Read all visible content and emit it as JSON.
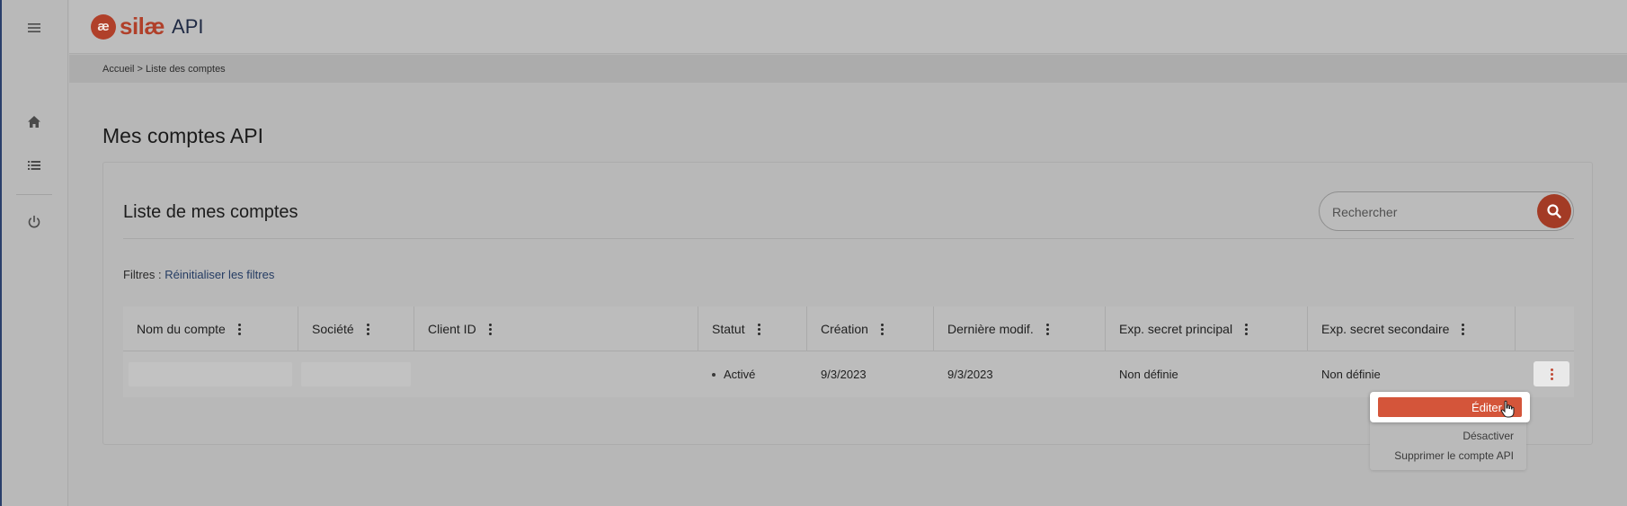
{
  "app": {
    "logo_mark": "æ",
    "logo_word": "silæ",
    "logo_suffix": "API"
  },
  "breadcrumb": {
    "home": "Accueil",
    "separator": ">",
    "current": "Liste des comptes"
  },
  "page": {
    "title": "Mes comptes API"
  },
  "card": {
    "title": "Liste de mes comptes",
    "search_placeholder": "Rechercher",
    "filters_label": "Filtres :",
    "filters_reset": "Réinitialiser les filtres"
  },
  "table": {
    "columns": [
      "Nom du compte",
      "Société",
      "Client ID",
      "Statut",
      "Création",
      "Dernière modif.",
      "Exp. secret principal",
      "Exp. secret secondaire"
    ],
    "rows": [
      {
        "nom_du_compte": "",
        "societe": "",
        "client_id": "",
        "statut": "Activé",
        "creation": "9/3/2023",
        "derniere_modif": "9/3/2023",
        "exp_secret_principal": "Non définie",
        "exp_secret_secondaire": "Non définie"
      }
    ]
  },
  "context_menu": {
    "edit": "Éditer",
    "deactivate": "Désactiver",
    "delete": "Supprimer le compte API"
  },
  "colors": {
    "brand": "#b0402a",
    "edit_button": "#d4553a",
    "search_button": "#a33b25"
  },
  "icons": {
    "menu": "hamburger-icon",
    "home": "home-icon",
    "list": "list-icon",
    "power": "power-icon",
    "search": "search-icon",
    "kebab": "kebab-icon"
  }
}
